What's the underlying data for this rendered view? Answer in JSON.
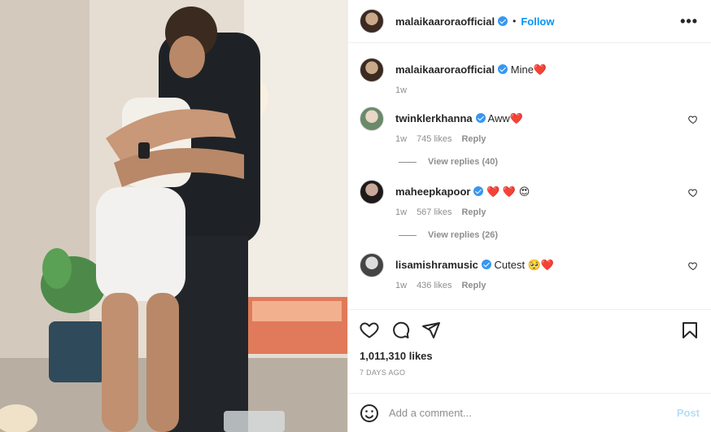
{
  "header": {
    "username": "malaikaaroraofficial",
    "dot": "•",
    "follow_label": "Follow",
    "more_label": "•••"
  },
  "caption": {
    "username": "malaikaaroraofficial",
    "text": "Mine❤️",
    "time": "1w"
  },
  "comments": [
    {
      "username": "twinklerkhanna",
      "text": "Aww❤️",
      "time": "1w",
      "likes": "745 likes",
      "reply": "Reply",
      "view_replies": "View replies (40)"
    },
    {
      "username": "maheepkapoor",
      "text": "❤️ ❤️ 😍",
      "time": "1w",
      "likes": "567 likes",
      "reply": "Reply",
      "view_replies": "View replies (26)"
    },
    {
      "username": "lisamishramusic",
      "text": "Cutest 🥺❤️",
      "time": "1w",
      "likes": "436 likes",
      "reply": "Reply"
    }
  ],
  "likes": "1,011,310 likes",
  "date": "7 DAYS AGO",
  "add_comment": {
    "placeholder": "Add a comment...",
    "post_label": "Post"
  },
  "colors": {
    "accent": "#0095f6",
    "verified": "#3897f0",
    "heart": "#ed4956"
  },
  "icons": [
    "like-icon",
    "comment-icon",
    "share-icon",
    "save-icon",
    "emoji-icon",
    "heart-icon",
    "verified-icon"
  ]
}
